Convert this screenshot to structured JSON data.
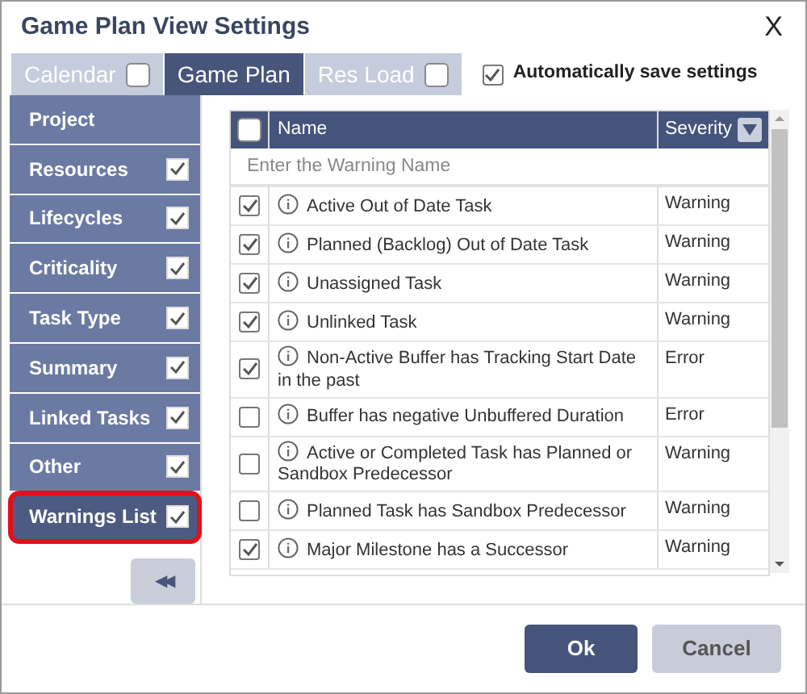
{
  "window": {
    "title": "Game Plan View Settings",
    "close": "X"
  },
  "tabs": [
    {
      "label": "Calendar",
      "selected": false,
      "checked": false
    },
    {
      "label": "Game Plan",
      "selected": true
    },
    {
      "label": "Res Load",
      "selected": false,
      "checked": false
    }
  ],
  "auto_save": {
    "label": "Automatically save settings",
    "checked": true
  },
  "sidebar": {
    "items": [
      {
        "label": "Project",
        "selected": false,
        "highlighted": false
      },
      {
        "label": "Resources",
        "checked": true,
        "selected": false,
        "highlighted": false
      },
      {
        "label": "Lifecycles",
        "checked": true,
        "selected": false,
        "highlighted": false
      },
      {
        "label": "Criticality",
        "checked": true,
        "selected": false,
        "highlighted": false
      },
      {
        "label": "Task Type",
        "checked": true,
        "selected": false,
        "highlighted": false
      },
      {
        "label": "Summary",
        "checked": true,
        "selected": false,
        "highlighted": false
      },
      {
        "label": "Linked Tasks",
        "checked": true,
        "selected": false,
        "highlighted": false
      },
      {
        "label": "Other",
        "checked": true,
        "selected": false,
        "highlighted": false
      },
      {
        "label": "Warnings List",
        "checked": true,
        "selected": true,
        "highlighted": true
      }
    ],
    "collapse": "◀◀"
  },
  "table": {
    "header_checked": false,
    "columns": [
      "Name",
      "Severity"
    ],
    "filter_placeholder": "Enter the Warning Name",
    "rows": [
      {
        "checked": true,
        "name": "Active Out of Date Task",
        "severity": "Warning"
      },
      {
        "checked": true,
        "name": "Planned (Backlog) Out of Date Task",
        "severity": "Warning"
      },
      {
        "checked": true,
        "name": "Unassigned Task",
        "severity": "Warning"
      },
      {
        "checked": true,
        "name": "Unlinked Task",
        "severity": "Warning"
      },
      {
        "checked": true,
        "name": "Non-Active Buffer has Tracking Start Date in the past",
        "severity": "Error"
      },
      {
        "checked": false,
        "name": "Buffer has negative Unbuffered Duration",
        "severity": "Error"
      },
      {
        "checked": false,
        "name": "Active or Completed Task has Planned or Sandbox Predecessor",
        "severity": "Warning"
      },
      {
        "checked": false,
        "name": "Planned Task has Sandbox Predecessor",
        "severity": "Warning"
      },
      {
        "checked": true,
        "name": "Major Milestone has a Successor",
        "severity": "Warning"
      }
    ]
  },
  "buttons": [
    {
      "label": "Ok",
      "kind": "primary"
    },
    {
      "label": "Cancel",
      "kind": "secondary"
    }
  ]
}
